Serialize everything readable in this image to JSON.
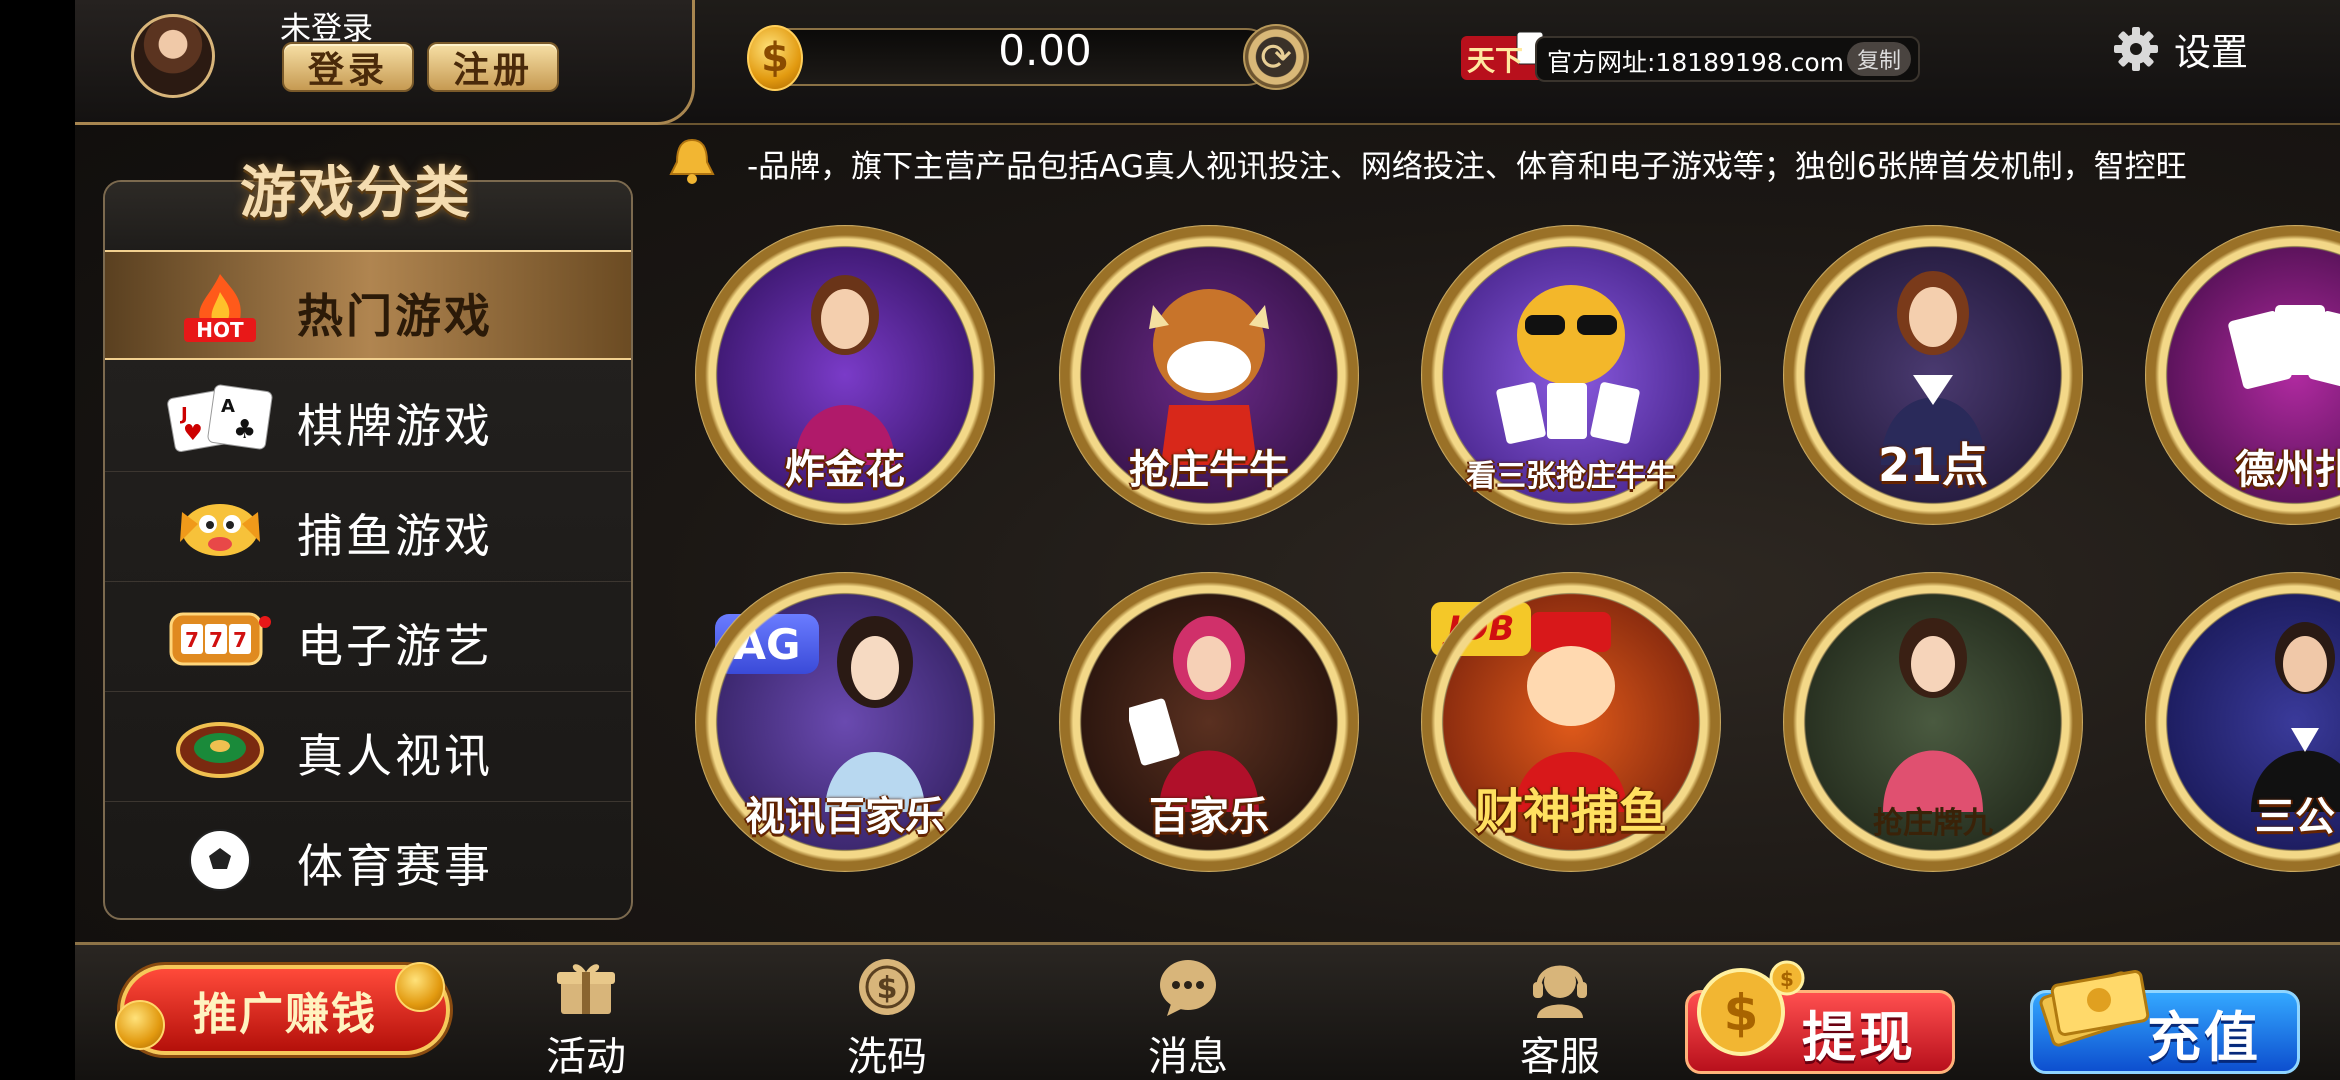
{
  "colors": {
    "gold": "#d8b57a",
    "panel_border": "#7c6a4f",
    "active_tab": "#b08550",
    "withdraw_red": "#d0162a",
    "recharge_blue": "#1f7ae8"
  },
  "header": {
    "username": "未登录",
    "login_label": "登录",
    "register_label": "注册",
    "balance": "0.00",
    "coin_icon": "coin-icon",
    "refresh_icon": "refresh-icon",
    "site_url": "官方网址:18189198.com",
    "copy_label": "复制",
    "settings_label": "设置",
    "settings_icon": "gear-icon"
  },
  "notice": {
    "icon": "bell-icon",
    "text": "-品牌，旗下主营产品包括AG真人视讯投注、网络投注、体育和电子游戏等；独创6张牌首发机制，智控旺"
  },
  "sidebar": {
    "title": "游戏分类",
    "items": [
      {
        "label": "热门游戏",
        "icon": "hot-fire-icon",
        "active": true
      },
      {
        "label": "棋牌游戏",
        "icon": "playing-cards-icon",
        "active": false
      },
      {
        "label": "捕鱼游戏",
        "icon": "fish-icon",
        "active": false
      },
      {
        "label": "电子游艺",
        "icon": "slot-machine-icon",
        "active": false
      },
      {
        "label": "真人视讯",
        "icon": "roulette-icon",
        "active": false
      },
      {
        "label": "体育赛事",
        "icon": "soccer-ball-icon",
        "active": false
      }
    ]
  },
  "games": [
    {
      "name": "炸金花"
    },
    {
      "name": "抢庄牛牛"
    },
    {
      "name": "看三张抢庄牛牛"
    },
    {
      "name": "21点"
    },
    {
      "name": "德州扑"
    },
    {
      "name": "视讯百家乐",
      "badge": "AG"
    },
    {
      "name": "百家乐"
    },
    {
      "name": "财神捕鱼",
      "badge": "JDB"
    },
    {
      "name": "抢庄牌九"
    },
    {
      "name": "三公"
    }
  ],
  "bottom_nav": {
    "promo_label": "推广赚钱",
    "items": [
      {
        "label": "活动",
        "icon": "gift-icon"
      },
      {
        "label": "洗码",
        "icon": "dollar-coin-icon"
      },
      {
        "label": "消息",
        "icon": "chat-bubble-icon"
      },
      {
        "label": "客服",
        "icon": "headset-icon"
      }
    ],
    "withdraw_label": "提现",
    "recharge_label": "充值"
  }
}
